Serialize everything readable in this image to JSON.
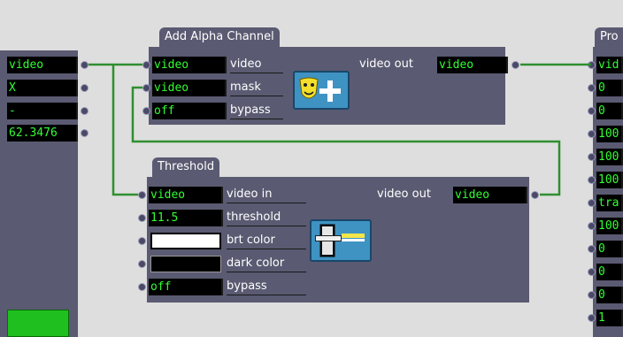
{
  "left_actor": {
    "values": [
      "video",
      "X",
      "-",
      "62.3476"
    ]
  },
  "add_alpha": {
    "title": "Add Alpha Channel",
    "inputs": [
      {
        "value": "video",
        "label": "video"
      },
      {
        "value": "video",
        "label": "mask"
      },
      {
        "value": "off",
        "label": "bypass"
      }
    ],
    "output": {
      "label": "video out",
      "value": "video"
    }
  },
  "threshold": {
    "title": "Threshold",
    "inputs": [
      {
        "value": "video",
        "label": "video in"
      },
      {
        "value": "11.5",
        "label": "threshold"
      },
      {
        "value": "",
        "label": "brt color"
      },
      {
        "value": "",
        "label": "dark color"
      },
      {
        "value": "off",
        "label": "bypass"
      }
    ],
    "output": {
      "label": "video out",
      "value": "video"
    }
  },
  "right_actor": {
    "title": "Pro",
    "values": [
      "vid",
      "0",
      "0",
      "100",
      "100",
      "100",
      "tra",
      "100",
      "0",
      "0",
      "0",
      "1"
    ]
  },
  "colors": {
    "background": "#dedede",
    "panel": "#5a5a72",
    "value_text": "#31ff31",
    "wire": "#2f8f2f",
    "brt_color": "#ffffff",
    "dark_color": "#000000",
    "left_green_block": "#1fbf1f"
  },
  "icons": {
    "add_alpha": "masks-plus-icon",
    "threshold": "threshold-slider-icon"
  }
}
